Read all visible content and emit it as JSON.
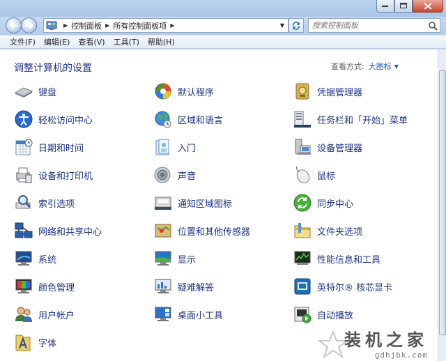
{
  "window": {
    "breadcrumbs": [
      "控制面板",
      "所有控制面板项"
    ],
    "search_placeholder": "搜索控制面板"
  },
  "menu": [
    "文件(F)",
    "编辑(E)",
    "查看(V)",
    "工具(T)",
    "帮助(H)"
  ],
  "content": {
    "heading": "调整计算机的设置",
    "view_mode_label": "查看方式:",
    "view_mode_value": "大图标"
  },
  "items": [
    {
      "label": "键盘",
      "icon": "keyboard-icon"
    },
    {
      "label": "默认程序",
      "icon": "default-programs-icon"
    },
    {
      "label": "凭据管理器",
      "icon": "credential-manager-icon"
    },
    {
      "label": "轻松访问中心",
      "icon": "ease-of-access-icon"
    },
    {
      "label": "区域和语言",
      "icon": "region-language-icon"
    },
    {
      "label": "任务栏和「开始」菜单",
      "icon": "taskbar-start-menu-icon"
    },
    {
      "label": "日期和时间",
      "icon": "date-time-icon"
    },
    {
      "label": "入门",
      "icon": "getting-started-icon"
    },
    {
      "label": "设备管理器",
      "icon": "device-manager-icon"
    },
    {
      "label": "设备和打印机",
      "icon": "devices-printers-icon"
    },
    {
      "label": "声音",
      "icon": "sound-icon"
    },
    {
      "label": "鼠标",
      "icon": "mouse-icon"
    },
    {
      "label": "索引选项",
      "icon": "indexing-options-icon"
    },
    {
      "label": "通知区域图标",
      "icon": "notification-area-icon"
    },
    {
      "label": "同步中心",
      "icon": "sync-center-icon"
    },
    {
      "label": "网络和共享中心",
      "icon": "network-sharing-icon"
    },
    {
      "label": "位置和其他传感器",
      "icon": "location-sensors-icon"
    },
    {
      "label": "文件夹选项",
      "icon": "folder-options-icon"
    },
    {
      "label": "系统",
      "icon": "system-icon"
    },
    {
      "label": "显示",
      "icon": "display-icon"
    },
    {
      "label": "性能信息和工具",
      "icon": "performance-icon"
    },
    {
      "label": "颜色管理",
      "icon": "color-management-icon"
    },
    {
      "label": "疑难解答",
      "icon": "troubleshooting-icon"
    },
    {
      "label": "英特尔® 核芯显卡",
      "icon": "intel-graphics-icon"
    },
    {
      "label": "用户帐户",
      "icon": "user-accounts-icon"
    },
    {
      "label": "桌面小工具",
      "icon": "desktop-gadgets-icon"
    },
    {
      "label": "自动播放",
      "icon": "autoplay-icon"
    },
    {
      "label": "字体",
      "icon": "fonts-icon"
    }
  ],
  "watermark": {
    "title": "装机之家",
    "url": "gdhjbk.com"
  }
}
